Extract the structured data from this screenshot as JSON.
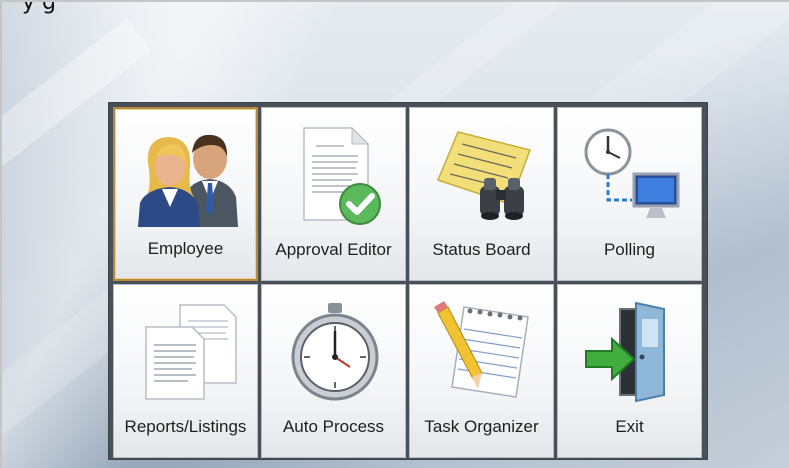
{
  "header": {
    "title_fragment": "y   g"
  },
  "menu": {
    "tiles": [
      {
        "label": "Employee",
        "icon": "employees-icon",
        "selected": true
      },
      {
        "label": "Approval Editor",
        "icon": "approved-document-icon",
        "selected": false
      },
      {
        "label": "Status Board",
        "icon": "binoculars-notepad-icon",
        "selected": false
      },
      {
        "label": "Polling",
        "icon": "clock-computer-icon",
        "selected": false
      },
      {
        "label": "Reports/Listings",
        "icon": "documents-icon",
        "selected": false
      },
      {
        "label": "Auto Process",
        "icon": "stopwatch-icon",
        "selected": false
      },
      {
        "label": "Task Organizer",
        "icon": "notepad-pencil-icon",
        "selected": false
      },
      {
        "label": "Exit",
        "icon": "exit-door-icon",
        "selected": false
      }
    ]
  },
  "colors": {
    "panel_bg": "#4a5058",
    "tile_bg": "#ffffff",
    "selected_border": "#b58a3c"
  }
}
